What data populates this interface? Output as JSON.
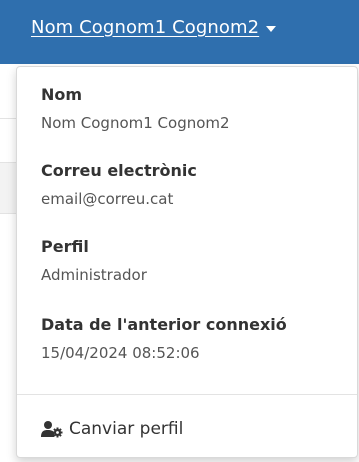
{
  "user_menu": {
    "toggle_label": "Nom Cognom1 Cognom2",
    "fields": [
      {
        "label": "Nom",
        "value": "Nom Cognom1 Cognom2"
      },
      {
        "label": "Correu electrònic",
        "value": "email@correu.cat"
      },
      {
        "label": "Perfil",
        "value": "Administrador"
      },
      {
        "label": "Data de l'anterior connexió",
        "value": "15/04/2024 08:52:06"
      }
    ],
    "change_profile_label": "Canviar perfil",
    "change_profile_icon": "user-cog-icon"
  },
  "colors": {
    "navbar": "#2f6fae",
    "text_dark": "#333333",
    "text_muted": "#555555"
  }
}
